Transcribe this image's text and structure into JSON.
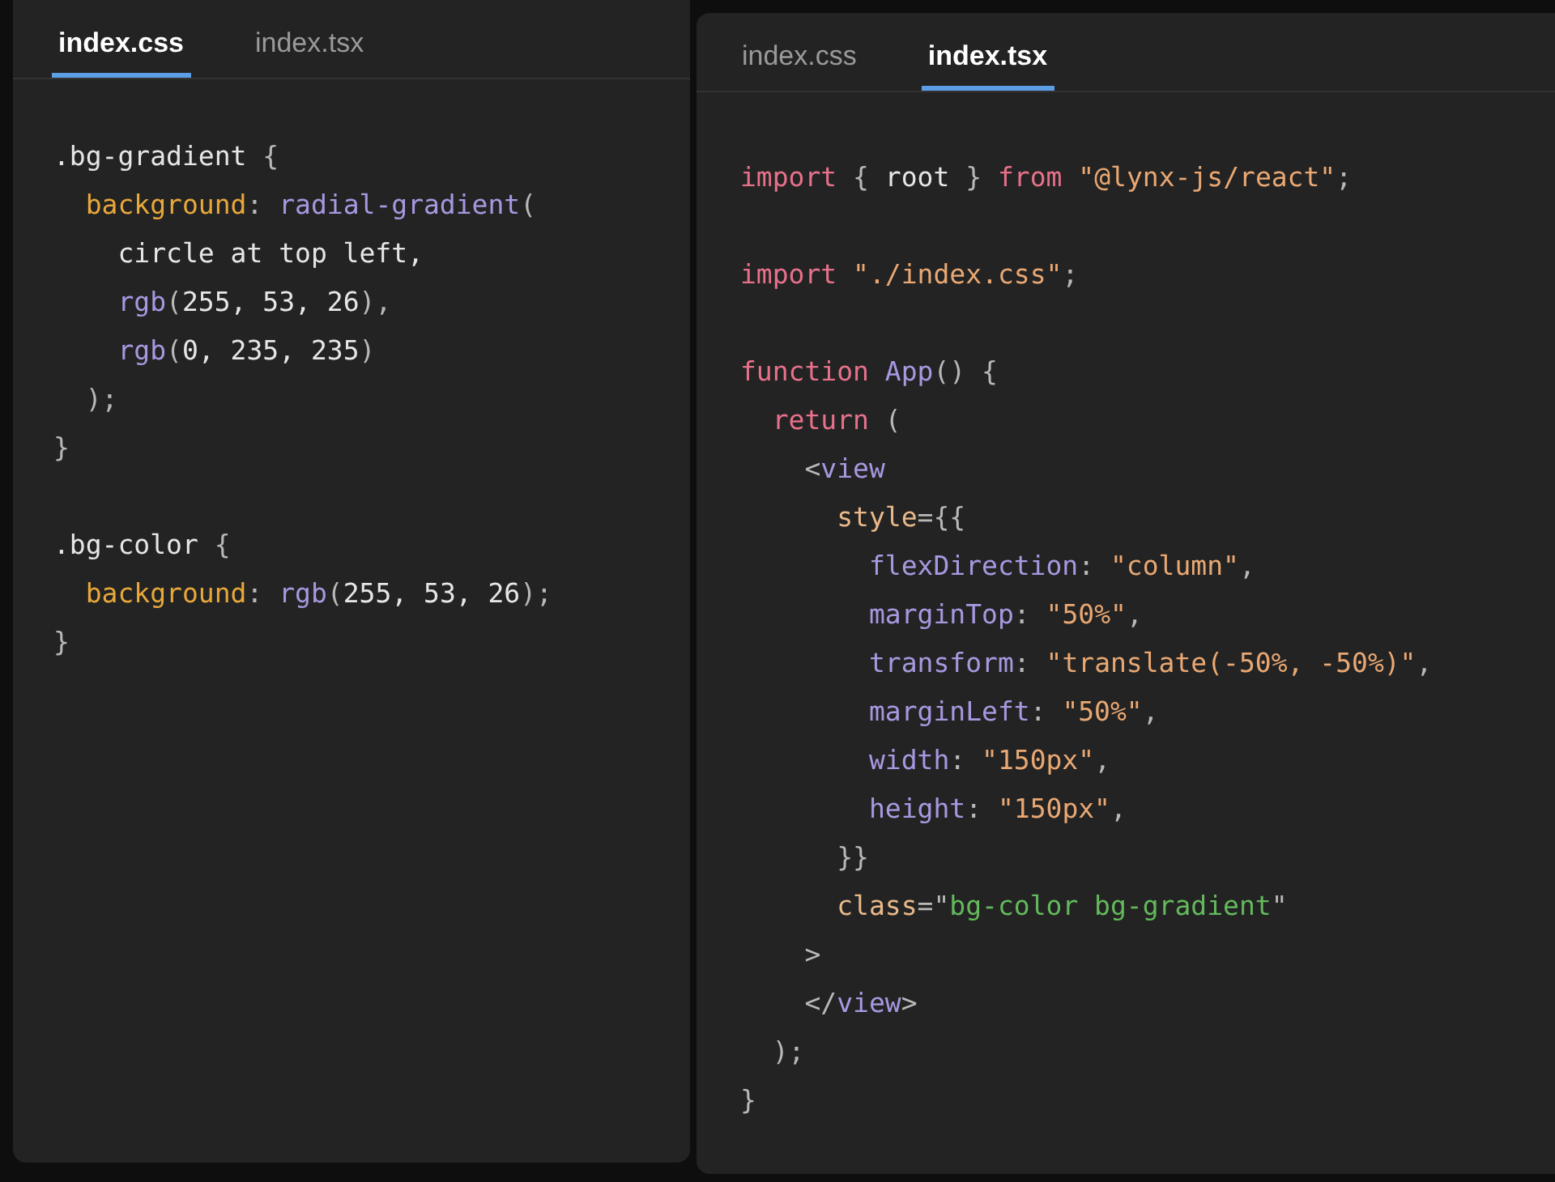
{
  "editors": [
    {
      "tabs": [
        {
          "label": "index.css",
          "selected": true
        },
        {
          "label": "index.tsx",
          "selected": false
        }
      ],
      "lines": [
        {
          "kind": "code",
          "tokens": [
            {
              "text": ".bg-gradient",
              "kind": "plain"
            },
            {
              "text": " {",
              "kind": "punct"
            }
          ]
        },
        {
          "kind": "code",
          "tokens": [
            {
              "text": "  background",
              "kind": "attr"
            },
            {
              "text": ": ",
              "kind": "punct"
            },
            {
              "text": "radial-gradient",
              "kind": "func"
            },
            {
              "text": "(",
              "kind": "punct"
            }
          ]
        },
        {
          "kind": "code",
          "tokens": [
            {
              "text": "    circle at top left,",
              "kind": "plain"
            }
          ]
        },
        {
          "kind": "code",
          "tokens": [
            {
              "text": "    rgb",
              "kind": "func"
            },
            {
              "text": "(",
              "kind": "punct"
            },
            {
              "text": "255, 53, 26",
              "kind": "plain"
            },
            {
              "text": "),",
              "kind": "punct"
            }
          ]
        },
        {
          "kind": "code",
          "tokens": [
            {
              "text": "    rgb",
              "kind": "func"
            },
            {
              "text": "(",
              "kind": "punct"
            },
            {
              "text": "0, 235, 235",
              "kind": "plain"
            },
            {
              "text": ")",
              "kind": "punct"
            }
          ]
        },
        {
          "kind": "code",
          "tokens": [
            {
              "text": "  );",
              "kind": "punct"
            }
          ]
        },
        {
          "kind": "code",
          "tokens": [
            {
              "text": "}",
              "kind": "punct"
            }
          ]
        },
        {
          "kind": "blank"
        },
        {
          "kind": "code",
          "tokens": [
            {
              "text": ".bg-color",
              "kind": "plain"
            },
            {
              "text": " {",
              "kind": "punct"
            }
          ]
        },
        {
          "kind": "code",
          "tokens": [
            {
              "text": "  background",
              "kind": "attr"
            },
            {
              "text": ": ",
              "kind": "punct"
            },
            {
              "text": "rgb",
              "kind": "func"
            },
            {
              "text": "(",
              "kind": "punct"
            },
            {
              "text": "255, 53, 26",
              "kind": "plain"
            },
            {
              "text": ");",
              "kind": "punct"
            }
          ]
        },
        {
          "kind": "code",
          "tokens": [
            {
              "text": "}",
              "kind": "punct"
            }
          ]
        }
      ]
    },
    {
      "tabs": [
        {
          "label": "index.css",
          "selected": false
        },
        {
          "label": "index.tsx",
          "selected": true
        }
      ],
      "lines": [
        {
          "kind": "code",
          "tokens": [
            {
              "text": "import",
              "kind": "keyword"
            },
            {
              "text": " { ",
              "kind": "punct"
            },
            {
              "text": "root",
              "kind": "plain"
            },
            {
              "text": " } ",
              "kind": "punct"
            },
            {
              "text": "from",
              "kind": "keyword"
            },
            {
              "text": " \"@lynx-js/react\"",
              "kind": "string"
            },
            {
              "text": ";",
              "kind": "punct"
            }
          ]
        },
        {
          "kind": "blank"
        },
        {
          "kind": "code",
          "tokens": [
            {
              "text": "import",
              "kind": "keyword"
            },
            {
              "text": " \"./index.css\"",
              "kind": "string"
            },
            {
              "text": ";",
              "kind": "punct"
            }
          ]
        },
        {
          "kind": "blank"
        },
        {
          "kind": "code",
          "tokens": [
            {
              "text": "function",
              "kind": "keyword"
            },
            {
              "text": " App",
              "kind": "func"
            },
            {
              "text": "() {",
              "kind": "punct"
            }
          ]
        },
        {
          "kind": "code",
          "tokens": [
            {
              "text": "  return",
              "kind": "keyword"
            },
            {
              "text": " (",
              "kind": "punct"
            }
          ]
        },
        {
          "kind": "code",
          "tokens": [
            {
              "text": "    <",
              "kind": "punct"
            },
            {
              "text": "view",
              "kind": "func"
            }
          ]
        },
        {
          "kind": "code",
          "tokens": [
            {
              "text": "      style",
              "kind": "jsxattr"
            },
            {
              "text": "={{",
              "kind": "punct"
            }
          ]
        },
        {
          "kind": "code",
          "tokens": [
            {
              "text": "        flexDirection",
              "kind": "func"
            },
            {
              "text": ": ",
              "kind": "punct"
            },
            {
              "text": "\"column\"",
              "kind": "string"
            },
            {
              "text": ",",
              "kind": "punct"
            }
          ]
        },
        {
          "kind": "code",
          "tokens": [
            {
              "text": "        marginTop",
              "kind": "func"
            },
            {
              "text": ": ",
              "kind": "punct"
            },
            {
              "text": "\"50%\"",
              "kind": "string"
            },
            {
              "text": ",",
              "kind": "punct"
            }
          ]
        },
        {
          "kind": "code",
          "tokens": [
            {
              "text": "        transform",
              "kind": "func"
            },
            {
              "text": ": ",
              "kind": "punct"
            },
            {
              "text": "\"translate(-50%, -50%)\"",
              "kind": "string"
            },
            {
              "text": ",",
              "kind": "punct"
            }
          ]
        },
        {
          "kind": "code",
          "tokens": [
            {
              "text": "        marginLeft",
              "kind": "func"
            },
            {
              "text": ": ",
              "kind": "punct"
            },
            {
              "text": "\"50%\"",
              "kind": "string"
            },
            {
              "text": ",",
              "kind": "punct"
            }
          ]
        },
        {
          "kind": "code",
          "tokens": [
            {
              "text": "        width",
              "kind": "func"
            },
            {
              "text": ": ",
              "kind": "punct"
            },
            {
              "text": "\"150px\"",
              "kind": "string"
            },
            {
              "text": ",",
              "kind": "punct"
            }
          ]
        },
        {
          "kind": "code",
          "tokens": [
            {
              "text": "        height",
              "kind": "func"
            },
            {
              "text": ": ",
              "kind": "punct"
            },
            {
              "text": "\"150px\"",
              "kind": "string"
            },
            {
              "text": ",",
              "kind": "punct"
            }
          ]
        },
        {
          "kind": "code",
          "tokens": [
            {
              "text": "      }}",
              "kind": "punct"
            }
          ]
        },
        {
          "kind": "code",
          "tokens": [
            {
              "text": "      class",
              "kind": "jsxattr"
            },
            {
              "text": "=\"",
              "kind": "punct"
            },
            {
              "text": "bg-color bg-gradient",
              "kind": "value"
            },
            {
              "text": "\"",
              "kind": "punct"
            }
          ]
        },
        {
          "kind": "code",
          "tokens": [
            {
              "text": "    >",
              "kind": "punct"
            }
          ]
        },
        {
          "kind": "code",
          "tokens": [
            {
              "text": "    </",
              "kind": "punct"
            },
            {
              "text": "view",
              "kind": "func"
            },
            {
              "text": ">",
              "kind": "punct"
            }
          ]
        },
        {
          "kind": "code",
          "tokens": [
            {
              "text": "  );",
              "kind": "punct"
            }
          ]
        },
        {
          "kind": "code",
          "tokens": [
            {
              "text": "}",
              "kind": "punct"
            }
          ]
        }
      ]
    }
  ]
}
